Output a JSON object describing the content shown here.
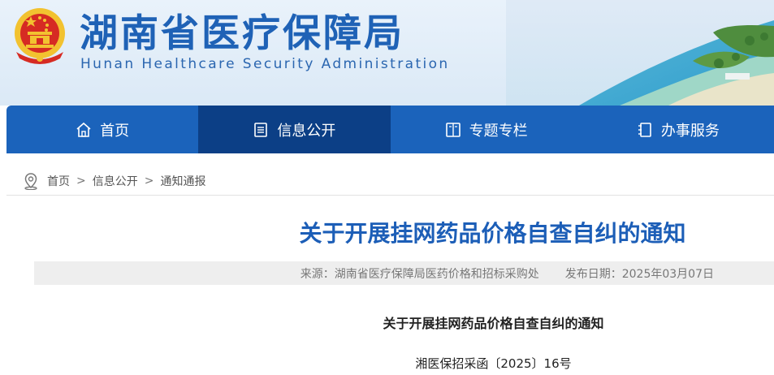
{
  "header": {
    "title": "湖南省医疗保障局",
    "subtitle": "Hunan Healthcare Security Administration",
    "logo": "national-emblem-icon"
  },
  "nav": {
    "items": [
      {
        "label": "首页",
        "icon": "home-icon",
        "active": false
      },
      {
        "label": "信息公开",
        "icon": "document-list-icon",
        "active": true
      },
      {
        "label": "专题专栏",
        "icon": "book-icon",
        "active": false
      },
      {
        "label": "办事服务",
        "icon": "service-book-icon",
        "active": false
      }
    ]
  },
  "breadcrumb": {
    "icon": "location-pin-icon",
    "items": [
      "首页",
      "信息公开",
      "通知通报"
    ],
    "separator": ">"
  },
  "article": {
    "title": "关于开展挂网药品价格自查自纠的通知",
    "source": "来源：湖南省医疗保障局医药价格和招标采购处",
    "date": "发布日期：2025年03月07日",
    "doc_title": "关于开展挂网药品价格自查自纠的通知",
    "doc_number": "湘医保招采函〔2025〕16号"
  },
  "colors": {
    "nav_bg": "#1b63bb",
    "nav_active": "#0c3f86",
    "title_blue": "#1c5eb7",
    "emblem_red": "#d62b23",
    "emblem_gold": "#f2c230"
  }
}
